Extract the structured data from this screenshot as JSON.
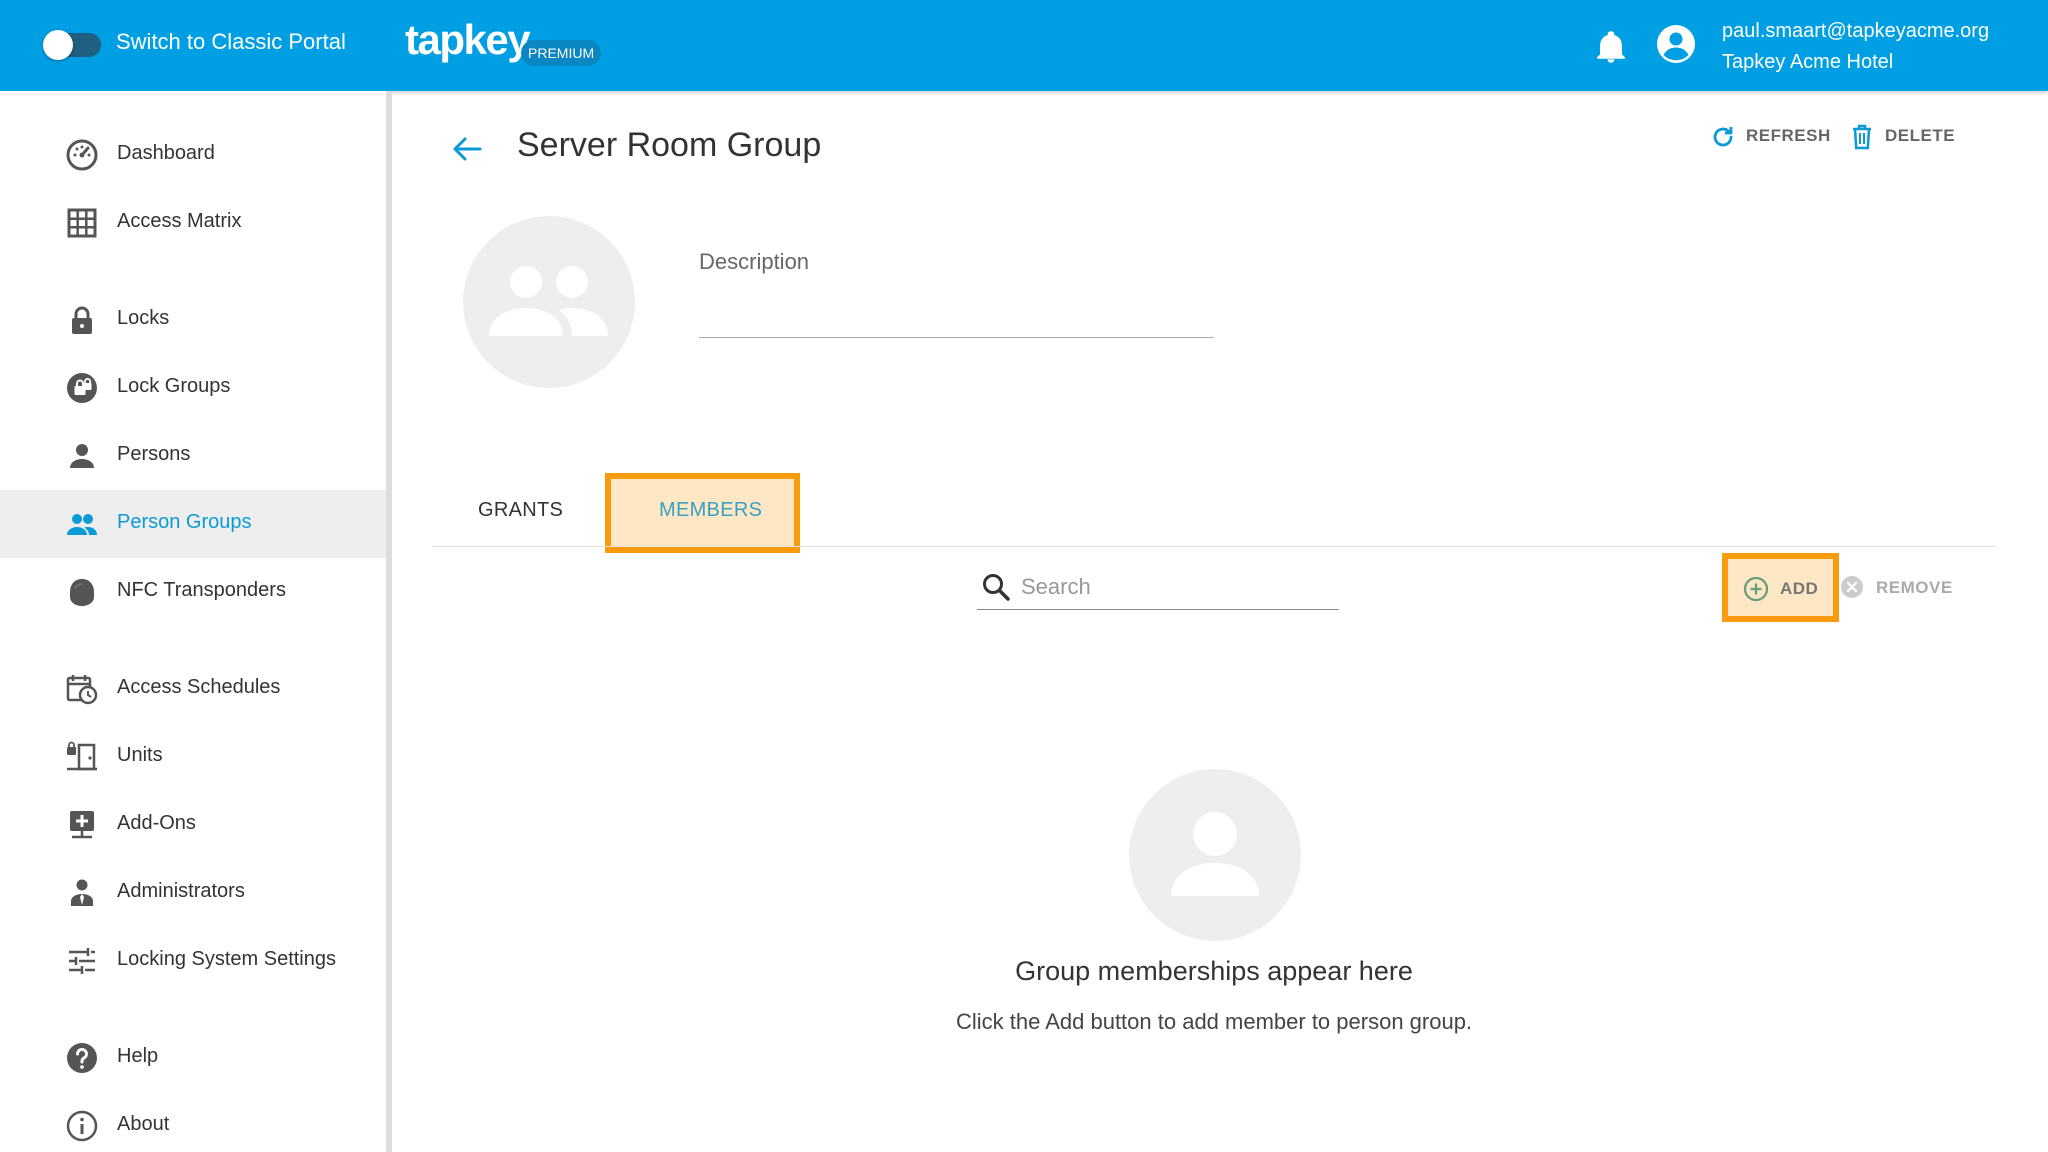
{
  "header": {
    "switch_label": "Switch to Classic Portal",
    "logo_text": "tapkey",
    "badge": "PREMIUM",
    "user_email": "paul.smaart@tapkeyacme.org",
    "user_org": "Tapkey Acme Hotel",
    "bar_color": "#009fe3"
  },
  "sidebar": {
    "items": [
      {
        "label": "Dashboard",
        "icon": "dashboard-icon"
      },
      {
        "label": "Access Matrix",
        "icon": "grid-icon"
      },
      {
        "label": "Locks",
        "icon": "lock-icon"
      },
      {
        "label": "Lock Groups",
        "icon": "lock-group-icon"
      },
      {
        "label": "Persons",
        "icon": "person-icon"
      },
      {
        "label": "Person Groups",
        "icon": "people-icon",
        "active": true
      },
      {
        "label": "NFC Transponders",
        "icon": "transponder-icon"
      },
      {
        "label": "Access Schedules",
        "icon": "calendar-clock-icon"
      },
      {
        "label": "Units",
        "icon": "unit-door-icon"
      },
      {
        "label": "Add-Ons",
        "icon": "add-on-icon"
      },
      {
        "label": "Administrators",
        "icon": "administrator-icon"
      },
      {
        "label": "Locking System Settings",
        "icon": "sliders-icon"
      },
      {
        "label": "Help",
        "icon": "help-icon"
      },
      {
        "label": "About",
        "icon": "info-icon"
      }
    ]
  },
  "main": {
    "title": "Server Room Group",
    "refresh_label": "REFRESH",
    "delete_label": "DELETE",
    "description_label": "Description",
    "description_value": "",
    "tabs": [
      {
        "label": "GRANTS"
      },
      {
        "label": "MEMBERS",
        "active": true
      }
    ],
    "search_placeholder": "Search",
    "add_label": "ADD",
    "remove_label": "REMOVE",
    "empty_title": "Group memberships appear here",
    "empty_subtitle": "Click the Add button to add member to person group."
  },
  "colors": {
    "accent": "#009fe3",
    "highlight_fill": "#fde7c4",
    "highlight_border": "#f89c0e"
  }
}
